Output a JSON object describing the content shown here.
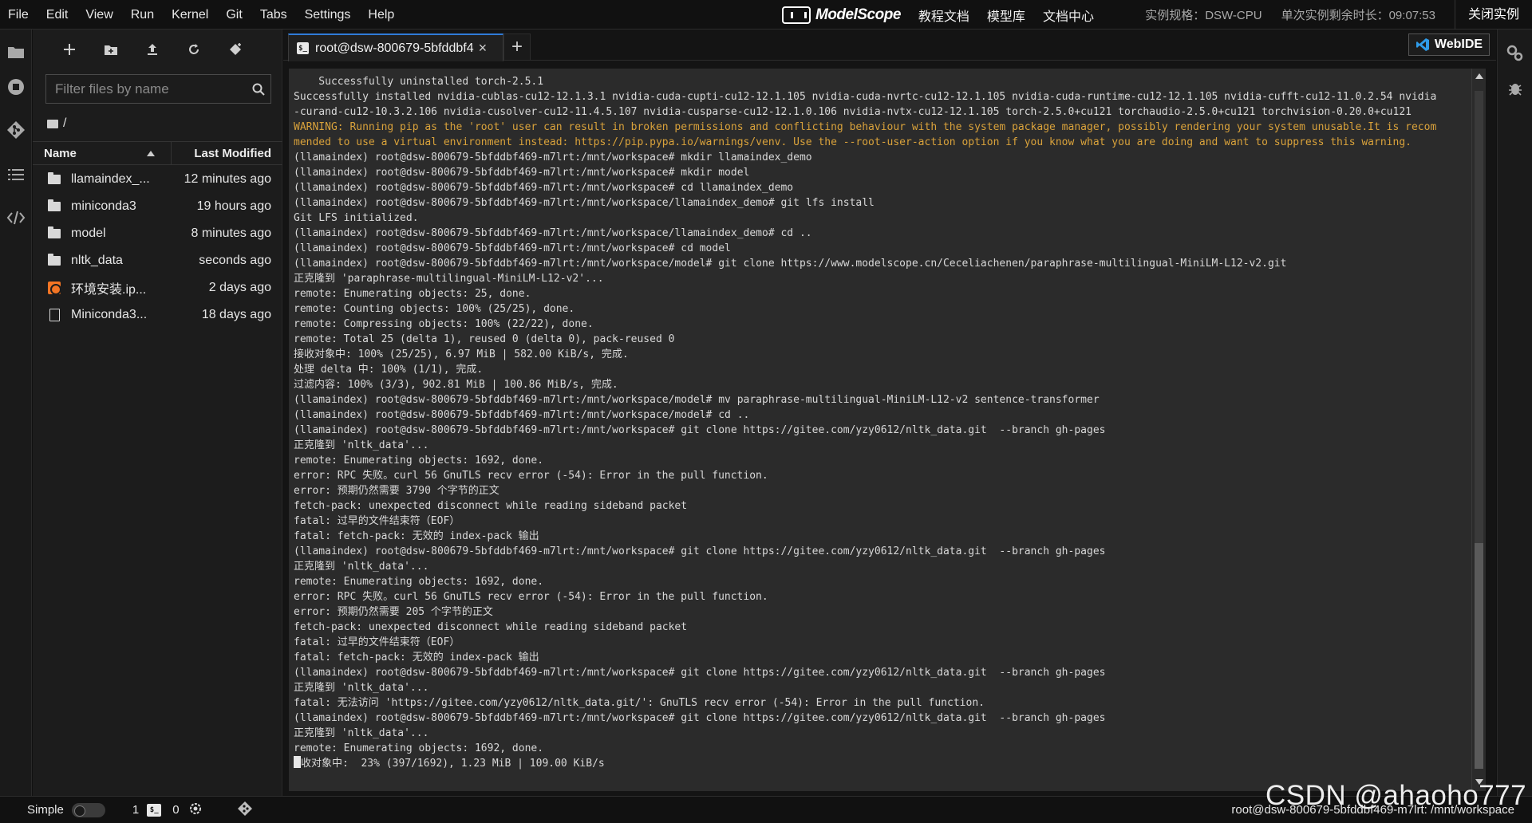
{
  "menubar": {
    "items": [
      "File",
      "Edit",
      "View",
      "Run",
      "Kernel",
      "Git",
      "Tabs",
      "Settings",
      "Help"
    ],
    "brand": "ModelScope",
    "links": [
      "教程文档",
      "模型库",
      "文档中心"
    ],
    "instance_spec": "实例规格：DSW-CPU",
    "remaining_time": "单次实例剩余时长：09:07:53",
    "close_instance": "关闭实例"
  },
  "filebrowser": {
    "filter_placeholder": "Filter files by name",
    "breadcrumb": "/",
    "header_name": "Name",
    "header_modified": "Last Modified",
    "files": [
      {
        "name": "llamaindex_...",
        "modified": "12 minutes ago",
        "icon": "folder-icon"
      },
      {
        "name": "miniconda3",
        "modified": "19 hours ago",
        "icon": "folder-icon"
      },
      {
        "name": "model",
        "modified": "8 minutes ago",
        "icon": "folder-icon"
      },
      {
        "name": "nltk_data",
        "modified": "seconds ago",
        "icon": "folder-icon"
      },
      {
        "name": "环境安装.ip...",
        "modified": "2 days ago",
        "icon": "notebook-icon"
      },
      {
        "name": "Miniconda3...",
        "modified": "18 days ago",
        "icon": "file-icon"
      }
    ]
  },
  "tabs": {
    "terminal_tab": "root@dsw-800679-5bfddbf4",
    "webide": "WebIDE"
  },
  "terminal": {
    "lines": [
      {
        "text": "    Successfully uninstalled torch-2.5.1",
        "style": "normal"
      },
      {
        "text": "Successfully installed nvidia-cublas-cu12-12.1.3.1 nvidia-cuda-cupti-cu12-12.1.105 nvidia-cuda-nvrtc-cu12-12.1.105 nvidia-cuda-runtime-cu12-12.1.105 nvidia-cufft-cu12-11.0.2.54 nvidia",
        "style": "normal"
      },
      {
        "text": "-curand-cu12-10.3.2.106 nvidia-cusolver-cu12-11.4.5.107 nvidia-cusparse-cu12-12.1.0.106 nvidia-nvtx-cu12-12.1.105 torch-2.5.0+cu121 torchaudio-2.5.0+cu121 torchvision-0.20.0+cu121",
        "style": "normal"
      },
      {
        "text": "WARNING: Running pip as the 'root' user can result in broken permissions and conflicting behaviour with the system package manager, possibly rendering your system unusable.It is recom",
        "style": "warn"
      },
      {
        "text": "mended to use a virtual environment instead: https://pip.pypa.io/warnings/venv. Use the --root-user-action option if you know what you are doing and want to suppress this warning.",
        "style": "warn"
      },
      {
        "text": "(llamaindex) root@dsw-800679-5bfddbf469-m7lrt:/mnt/workspace# mkdir llamaindex_demo",
        "style": "normal"
      },
      {
        "text": "(llamaindex) root@dsw-800679-5bfddbf469-m7lrt:/mnt/workspace# mkdir model",
        "style": "normal"
      },
      {
        "text": "(llamaindex) root@dsw-800679-5bfddbf469-m7lrt:/mnt/workspace# cd llamaindex_demo",
        "style": "normal"
      },
      {
        "text": "(llamaindex) root@dsw-800679-5bfddbf469-m7lrt:/mnt/workspace/llamaindex_demo# git lfs install",
        "style": "normal"
      },
      {
        "text": "Git LFS initialized.",
        "style": "normal"
      },
      {
        "text": "(llamaindex) root@dsw-800679-5bfddbf469-m7lrt:/mnt/workspace/llamaindex_demo# cd ..",
        "style": "normal"
      },
      {
        "text": "(llamaindex) root@dsw-800679-5bfddbf469-m7lrt:/mnt/workspace# cd model",
        "style": "normal"
      },
      {
        "text": "(llamaindex) root@dsw-800679-5bfddbf469-m7lrt:/mnt/workspace/model# git clone https://www.modelscope.cn/Ceceliachenen/paraphrase-multilingual-MiniLM-L12-v2.git",
        "style": "normal"
      },
      {
        "text": "正克隆到 'paraphrase-multilingual-MiniLM-L12-v2'...",
        "style": "normal"
      },
      {
        "text": "remote: Enumerating objects: 25, done.",
        "style": "normal"
      },
      {
        "text": "remote: Counting objects: 100% (25/25), done.",
        "style": "normal"
      },
      {
        "text": "remote: Compressing objects: 100% (22/22), done.",
        "style": "normal"
      },
      {
        "text": "remote: Total 25 (delta 1), reused 0 (delta 0), pack-reused 0",
        "style": "normal"
      },
      {
        "text": "接收对象中: 100% (25/25), 6.97 MiB | 582.00 KiB/s, 完成.",
        "style": "normal"
      },
      {
        "text": "处理 delta 中: 100% (1/1), 完成.",
        "style": "normal"
      },
      {
        "text": "过滤内容: 100% (3/3), 902.81 MiB | 100.86 MiB/s, 完成.",
        "style": "normal"
      },
      {
        "text": "(llamaindex) root@dsw-800679-5bfddbf469-m7lrt:/mnt/workspace/model# mv paraphrase-multilingual-MiniLM-L12-v2 sentence-transformer",
        "style": "normal"
      },
      {
        "text": "(llamaindex) root@dsw-800679-5bfddbf469-m7lrt:/mnt/workspace/model# cd ..",
        "style": "normal"
      },
      {
        "text": "(llamaindex) root@dsw-800679-5bfddbf469-m7lrt:/mnt/workspace# git clone https://gitee.com/yzy0612/nltk_data.git  --branch gh-pages",
        "style": "normal"
      },
      {
        "text": "正克隆到 'nltk_data'...",
        "style": "normal"
      },
      {
        "text": "remote: Enumerating objects: 1692, done.",
        "style": "normal"
      },
      {
        "text": "error: RPC 失败。curl 56 GnuTLS recv error (-54): Error in the pull function.",
        "style": "normal"
      },
      {
        "text": "error: 预期仍然需要 3790 个字节的正文",
        "style": "normal"
      },
      {
        "text": "fetch-pack: unexpected disconnect while reading sideband packet",
        "style": "normal"
      },
      {
        "text": "fatal: 过早的文件结束符（EOF）",
        "style": "normal"
      },
      {
        "text": "fatal: fetch-pack: 无效的 index-pack 输出",
        "style": "normal"
      },
      {
        "text": "(llamaindex) root@dsw-800679-5bfddbf469-m7lrt:/mnt/workspace# git clone https://gitee.com/yzy0612/nltk_data.git  --branch gh-pages",
        "style": "normal"
      },
      {
        "text": "正克隆到 'nltk_data'...",
        "style": "normal"
      },
      {
        "text": "remote: Enumerating objects: 1692, done.",
        "style": "normal"
      },
      {
        "text": "error: RPC 失败。curl 56 GnuTLS recv error (-54): Error in the pull function.",
        "style": "normal"
      },
      {
        "text": "error: 预期仍然需要 205 个字节的正文",
        "style": "normal"
      },
      {
        "text": "fetch-pack: unexpected disconnect while reading sideband packet",
        "style": "normal"
      },
      {
        "text": "fatal: 过早的文件结束符（EOF）",
        "style": "normal"
      },
      {
        "text": "fatal: fetch-pack: 无效的 index-pack 输出",
        "style": "normal"
      },
      {
        "text": "(llamaindex) root@dsw-800679-5bfddbf469-m7lrt:/mnt/workspace# git clone https://gitee.com/yzy0612/nltk_data.git  --branch gh-pages",
        "style": "normal"
      },
      {
        "text": "正克隆到 'nltk_data'...",
        "style": "normal"
      },
      {
        "text": "fatal: 无法访问 'https://gitee.com/yzy0612/nltk_data.git/': GnuTLS recv error (-54): Error in the pull function.",
        "style": "normal"
      },
      {
        "text": "(llamaindex) root@dsw-800679-5bfddbf469-m7lrt:/mnt/workspace# git clone https://gitee.com/yzy0612/nltk_data.git  --branch gh-pages",
        "style": "normal"
      },
      {
        "text": "正克隆到 'nltk_data'...",
        "style": "normal"
      },
      {
        "text": "remote: Enumerating objects: 1692, done.",
        "style": "normal"
      },
      {
        "text": "收对象中:  23% (397/1692), 1.23 MiB | 109.00 KiB/s",
        "style": "cursor"
      }
    ]
  },
  "statusbar": {
    "simple_label": "Simple",
    "kernel_count": "1",
    "terminal_count": "0",
    "path": "root@dsw-800679-5bfddbf469-m7lrt: /mnt/workspace"
  },
  "watermark": "CSDN @ahaoho777",
  "colors": {
    "accent": "#2f7bd8",
    "warning_text": "#d9a23b",
    "terminal_bg": "#2b2b2b"
  }
}
